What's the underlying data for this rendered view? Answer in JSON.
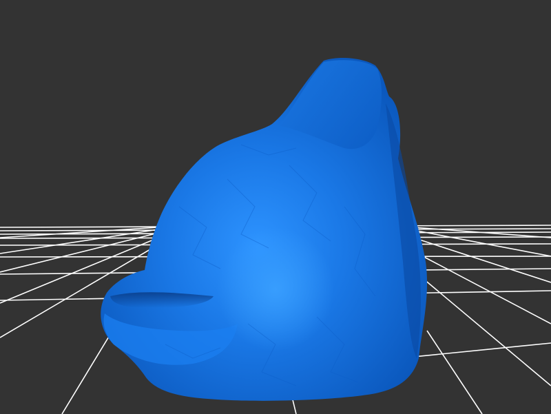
{
  "viewer": {
    "background_color": "#333333",
    "grid_color": "#ffffff",
    "model_color": "#1a73e0",
    "model_highlight_color": "#2b8fff",
    "model_shadow_color": "#0a4fae"
  }
}
